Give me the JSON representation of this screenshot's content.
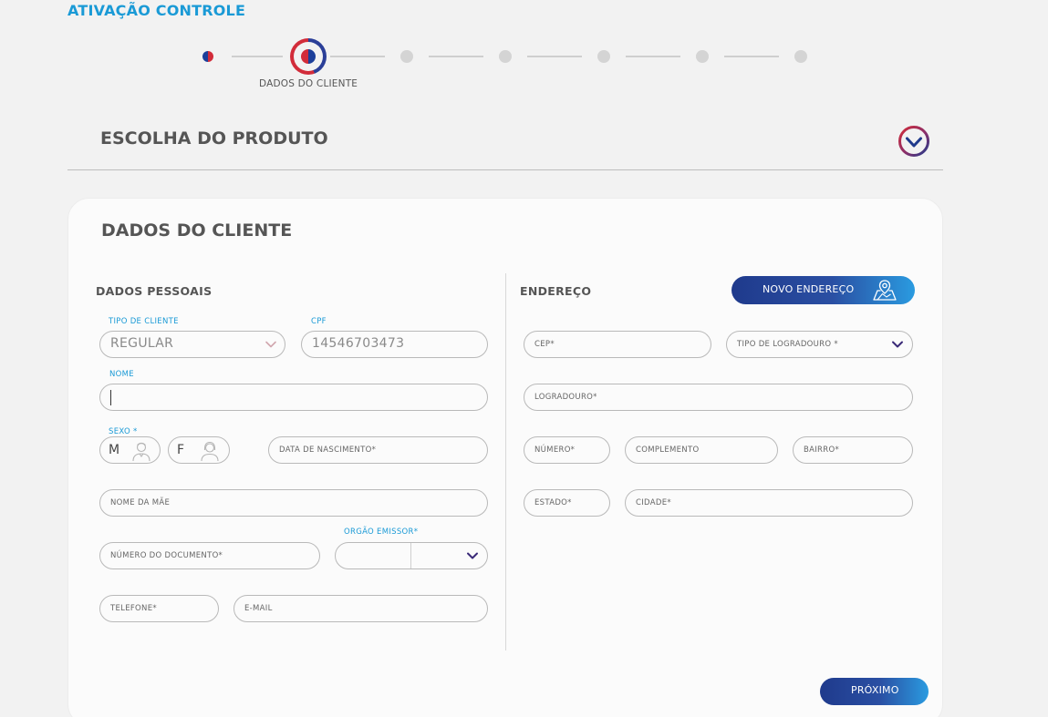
{
  "header": {
    "title": "ATIVAÇÃO CONTROLE"
  },
  "stepper": {
    "current_label": "DADOS DO CLIENTE"
  },
  "product_section": {
    "title": "ESCOLHA DO PRODUTO",
    "toggle_icon": "chevron-down-circle-icon"
  },
  "card": {
    "title": "DADOS DO CLIENTE"
  },
  "personal": {
    "title": "DADOS PESSOAIS",
    "client_type": {
      "label": "TIPO DE CLIENTE",
      "value": "REGULAR"
    },
    "cpf": {
      "label": "CPF",
      "value": "14546703473"
    },
    "name": {
      "label": "NOME",
      "value": ""
    },
    "sex": {
      "label": "SEXO *",
      "male": "M",
      "female": "F"
    },
    "birth_date": {
      "placeholder": "DATA DE NASCIMENTO*"
    },
    "mother_name": {
      "placeholder": "NOME DA MÃE"
    },
    "document_number": {
      "placeholder": "NÚMERO DO DOCUMENTO*"
    },
    "issuer": {
      "label": "ORGÃO EMISSOR*"
    },
    "phone": {
      "placeholder": "TELEFONE*"
    },
    "email": {
      "placeholder": "E-MAIL"
    }
  },
  "address": {
    "title": "ENDEREÇO",
    "new_address_button": "NOVO ENDEREÇO",
    "cep": {
      "placeholder": "CEP*"
    },
    "street_type": {
      "placeholder": "TIPO DE LOGRADOURO *"
    },
    "street": {
      "placeholder": "LOGRADOURO*"
    },
    "number": {
      "placeholder": "NÚMERO*"
    },
    "complement": {
      "placeholder": "COMPLEMENTO"
    },
    "neighborhood": {
      "placeholder": "BAIRRO*"
    },
    "state": {
      "placeholder": "ESTADO*"
    },
    "city": {
      "placeholder": "CIDADE*"
    }
  },
  "footer": {
    "next_button": "PRÓXIMO"
  },
  "colors": {
    "accent_blue": "#1a9ad6",
    "brand_navy": "#1f3a8c",
    "brand_red": "#d22c3a"
  }
}
